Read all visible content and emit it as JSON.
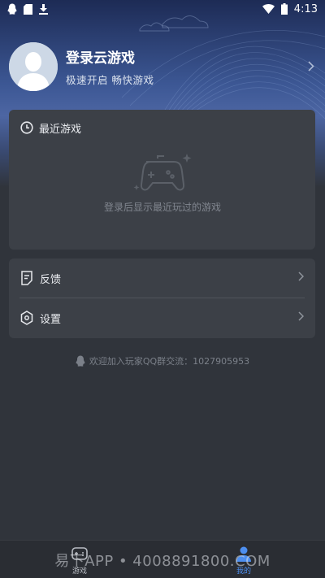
{
  "status": {
    "time": "4:13"
  },
  "profile": {
    "title": "登录云游戏",
    "subtitle": "极速开启 畅快游戏"
  },
  "recent": {
    "title": "最近游戏",
    "empty_text": "登录后显示最近玩过的游戏"
  },
  "menu": {
    "items": [
      {
        "label": "反馈",
        "icon": "feedback-icon"
      },
      {
        "label": "设置",
        "icon": "settings-hex-icon"
      }
    ]
  },
  "qq_group": {
    "text": "欢迎加入玩家QQ群交流：1027905953"
  },
  "nav": {
    "items": [
      {
        "label": "游戏",
        "icon": "gamepad-icon",
        "active": false
      },
      {
        "label": "我的",
        "icon": "person-icon",
        "active": true
      }
    ]
  },
  "watermark": {
    "text": "易下APP • 4008891800.COM"
  },
  "colors": {
    "accent": "#4d8ff0",
    "background": "#30343b",
    "card": "#3c4047"
  }
}
